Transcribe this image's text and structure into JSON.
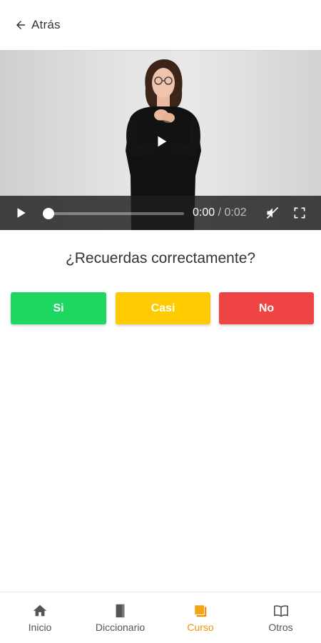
{
  "header": {
    "back_label": "Atrás"
  },
  "video": {
    "current_time": "0:00",
    "separator": " / ",
    "duration": "0:02",
    "progress": 0.0
  },
  "question": "¿Recuerdas correctamente?",
  "answers": [
    {
      "label": "Si",
      "color": "#1ed760"
    },
    {
      "label": "Casi",
      "color": "#fecb00"
    },
    {
      "label": "No",
      "color": "#ee4444"
    }
  ],
  "bottom_nav": {
    "items": [
      {
        "label": "Inicio",
        "icon": "home-icon"
      },
      {
        "label": "Diccionario",
        "icon": "dictionary-icon"
      },
      {
        "label": "Curso",
        "icon": "course-icon",
        "active": true
      },
      {
        "label": "Otros",
        "icon": "book-open-icon"
      }
    ],
    "active_color": "#f39200"
  }
}
